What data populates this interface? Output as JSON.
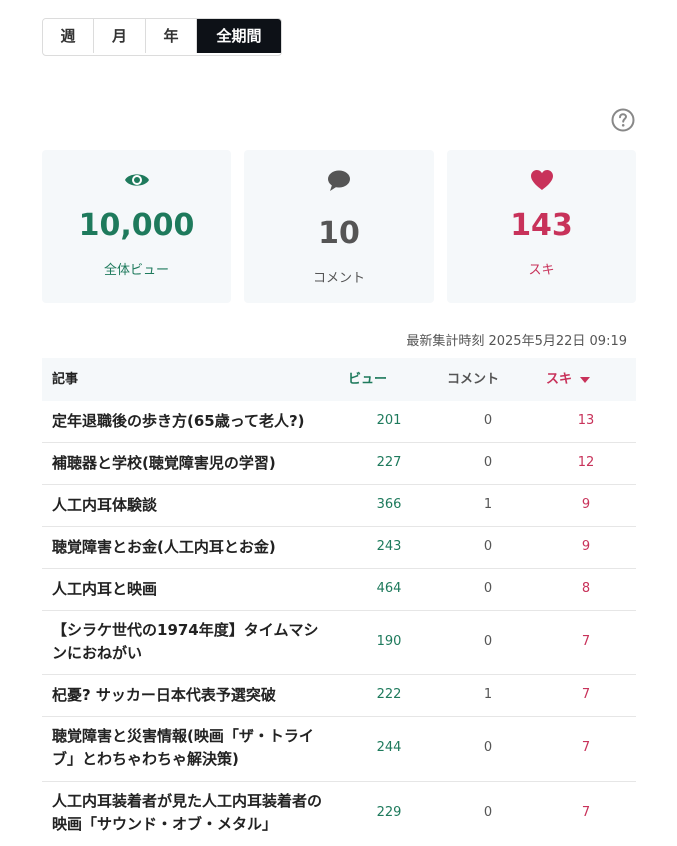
{
  "period_tabs": [
    {
      "label": "週",
      "active": false
    },
    {
      "label": "月",
      "active": false
    },
    {
      "label": "年",
      "active": false
    },
    {
      "label": "全期間",
      "active": true
    }
  ],
  "summary": {
    "views": {
      "value": "10,000",
      "label": "全体ビュー",
      "icon": "eye-icon",
      "color": "#1e7a5c"
    },
    "comments": {
      "value": "10",
      "label": "コメント",
      "icon": "comment-icon",
      "color": "#555555"
    },
    "likes": {
      "value": "143",
      "label": "スキ",
      "icon": "heart-icon",
      "color": "#c8325a"
    }
  },
  "timestamp": "最新集計時刻 2025年5月22日 09:19",
  "table": {
    "headers": {
      "article": "記事",
      "views": "ビュー",
      "comments": "コメント",
      "likes": "スキ"
    },
    "rows": [
      {
        "title": "定年退職後の歩き方(65歳って老人?)",
        "views": "201",
        "comments": "0",
        "likes": "13"
      },
      {
        "title": "補聴器と学校(聴覚障害児の学習)",
        "views": "227",
        "comments": "0",
        "likes": "12"
      },
      {
        "title": "人工内耳体験談",
        "views": "366",
        "comments": "1",
        "likes": "9"
      },
      {
        "title": "聴覚障害とお金(人工内耳とお金)",
        "views": "243",
        "comments": "0",
        "likes": "9"
      },
      {
        "title": "人工内耳と映画",
        "views": "464",
        "comments": "0",
        "likes": "8"
      },
      {
        "title": "【シラケ世代の1974年度】タイムマシンにおねがい",
        "views": "190",
        "comments": "0",
        "likes": "7"
      },
      {
        "title": "杞憂? サッカー日本代表予選突破",
        "views": "222",
        "comments": "1",
        "likes": "7"
      },
      {
        "title": "聴覚障害と災害情報(映画「ザ・トライブ」とわちゃわちゃ解決策)",
        "views": "244",
        "comments": "0",
        "likes": "7"
      },
      {
        "title": "人工内耳装着者が見た人工内耳装着者の映画「サウンド・オブ・メタル」",
        "views": "229",
        "comments": "0",
        "likes": "7"
      }
    ]
  }
}
